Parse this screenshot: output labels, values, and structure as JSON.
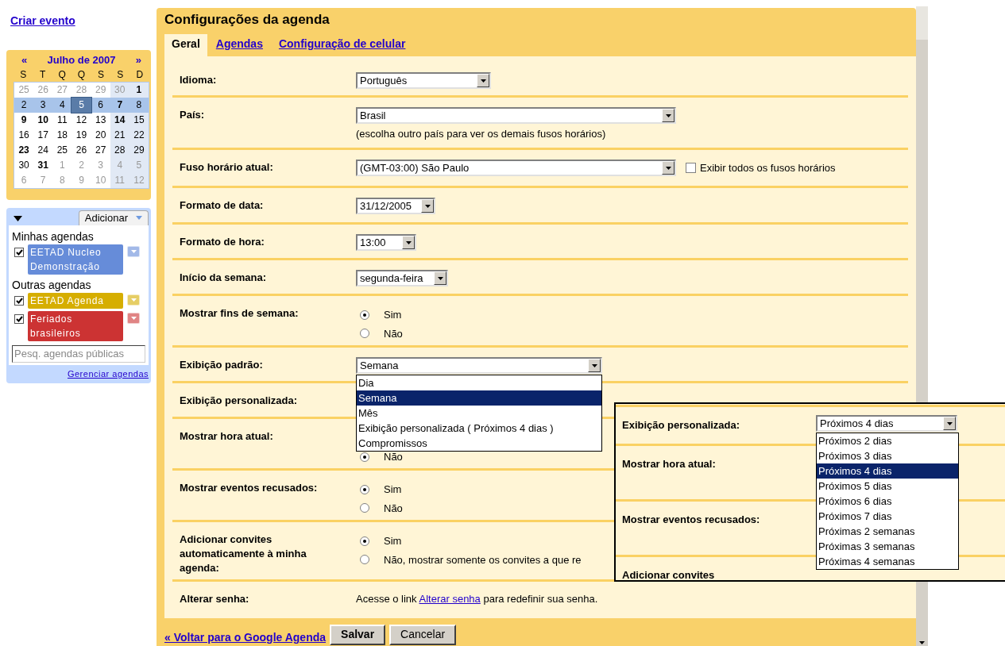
{
  "sidebar": {
    "create_event": "Criar evento",
    "mini_calendar": {
      "prev": "«",
      "title": "Julho de 2007",
      "next": "»",
      "weekdays": [
        "S",
        "T",
        "Q",
        "Q",
        "S",
        "S",
        "D"
      ],
      "weeks": [
        {
          "selected": false,
          "days": [
            {
              "d": "25",
              "kind": "other"
            },
            {
              "d": "26",
              "kind": "other"
            },
            {
              "d": "27",
              "kind": "other"
            },
            {
              "d": "28",
              "kind": "other"
            },
            {
              "d": "29",
              "kind": "other"
            },
            {
              "d": "30",
              "kind": "other"
            },
            {
              "d": "1",
              "kind": "bold"
            }
          ]
        },
        {
          "selected": true,
          "days": [
            {
              "d": "2",
              "kind": "plain"
            },
            {
              "d": "3",
              "kind": "plain"
            },
            {
              "d": "4",
              "kind": "plain"
            },
            {
              "d": "5",
              "kind": "today"
            },
            {
              "d": "6",
              "kind": "plain"
            },
            {
              "d": "7",
              "kind": "bold"
            },
            {
              "d": "8",
              "kind": "plain"
            }
          ]
        },
        {
          "selected": false,
          "days": [
            {
              "d": "9",
              "kind": "bold"
            },
            {
              "d": "10",
              "kind": "bold"
            },
            {
              "d": "11",
              "kind": "plain"
            },
            {
              "d": "12",
              "kind": "plain"
            },
            {
              "d": "13",
              "kind": "plain"
            },
            {
              "d": "14",
              "kind": "bold"
            },
            {
              "d": "15",
              "kind": "plain"
            }
          ]
        },
        {
          "selected": false,
          "days": [
            {
              "d": "16",
              "kind": "plain"
            },
            {
              "d": "17",
              "kind": "plain"
            },
            {
              "d": "18",
              "kind": "plain"
            },
            {
              "d": "19",
              "kind": "plain"
            },
            {
              "d": "20",
              "kind": "plain"
            },
            {
              "d": "21",
              "kind": "plain"
            },
            {
              "d": "22",
              "kind": "plain"
            }
          ]
        },
        {
          "selected": false,
          "days": [
            {
              "d": "23",
              "kind": "bold"
            },
            {
              "d": "24",
              "kind": "plain"
            },
            {
              "d": "25",
              "kind": "plain"
            },
            {
              "d": "26",
              "kind": "plain"
            },
            {
              "d": "27",
              "kind": "plain"
            },
            {
              "d": "28",
              "kind": "plain"
            },
            {
              "d": "29",
              "kind": "plain"
            }
          ]
        },
        {
          "selected": false,
          "days": [
            {
              "d": "30",
              "kind": "plain"
            },
            {
              "d": "31",
              "kind": "bold"
            },
            {
              "d": "1",
              "kind": "other"
            },
            {
              "d": "2",
              "kind": "other"
            },
            {
              "d": "3",
              "kind": "other"
            },
            {
              "d": "4",
              "kind": "other"
            },
            {
              "d": "5",
              "kind": "other"
            }
          ]
        },
        {
          "selected": false,
          "days": [
            {
              "d": "6",
              "kind": "other"
            },
            {
              "d": "7",
              "kind": "other"
            },
            {
              "d": "8",
              "kind": "other"
            },
            {
              "d": "9",
              "kind": "other"
            },
            {
              "d": "10",
              "kind": "other"
            },
            {
              "d": "11",
              "kind": "other"
            },
            {
              "d": "12",
              "kind": "other"
            }
          ]
        }
      ]
    },
    "calendars": {
      "add_button": "Adicionar",
      "groups": [
        {
          "title": "Minhas agendas",
          "items": [
            {
              "name": "EETAD Nucleo Demonstração",
              "checked": true,
              "color": "#668cd9"
            }
          ]
        },
        {
          "title": "Outras agendas",
          "items": [
            {
              "name": "EETAD Agenda",
              "checked": true,
              "color": "#d6ae00"
            },
            {
              "name": "Feriados brasileiros",
              "checked": true,
              "color": "#cc3333"
            }
          ]
        }
      ],
      "search": {
        "placeholder": "Pesq. agendas públicas"
      },
      "manage_link": "Gerenciar agendas"
    }
  },
  "settings": {
    "title": "Configurações da agenda",
    "tabs": [
      {
        "label": "Geral",
        "selected": true
      },
      {
        "label": "Agendas",
        "selected": false
      },
      {
        "label": "Configuração de celular",
        "selected": false
      }
    ],
    "rows": [
      {
        "kind": "select",
        "label": "Idioma:",
        "value": "Português"
      },
      {
        "kind": "select",
        "label": "País:",
        "value": "Brasil",
        "note": "(escolha outro país para ver os demais fusos horários)"
      },
      {
        "kind": "select",
        "label": "Fuso horário atual:",
        "value": "(GMT-03:00) São Paulo",
        "checkbox": {
          "label": "Exibir todos os fusos horários",
          "checked": false
        }
      },
      {
        "kind": "select",
        "label": "Formato de data:",
        "value": "31/12/2005"
      },
      {
        "kind": "select",
        "label": "Formato de hora:",
        "value": "13:00"
      },
      {
        "kind": "select",
        "label": "Início da semana:",
        "value": "segunda-feira"
      },
      {
        "kind": "radio",
        "label": "Mostrar fins de semana:",
        "options": [
          {
            "label": "Sim",
            "selected": true
          },
          {
            "label": "Não",
            "selected": false
          }
        ]
      },
      {
        "kind": "select",
        "label": "Exibição padrão:",
        "value": "Semana",
        "open": true,
        "options": [
          {
            "label": "Dia",
            "selected": false
          },
          {
            "label": "Semana",
            "selected": true
          },
          {
            "label": "Mês",
            "selected": false
          },
          {
            "label": "Exibição personalizada ( Próximos 4 dias )",
            "selected": false
          },
          {
            "label": "Compromissos",
            "selected": false
          }
        ]
      },
      {
        "kind": "blank",
        "label": "Exibição personalizada:"
      },
      {
        "kind": "radio",
        "label": "Mostrar hora atual:",
        "options": [
          {
            "label": "Não",
            "selected": true
          }
        ]
      },
      {
        "kind": "radio",
        "label": "Mostrar eventos recusados:",
        "options": [
          {
            "label": "Sim",
            "selected": true
          },
          {
            "label": "Não",
            "selected": false
          }
        ]
      },
      {
        "kind": "radio",
        "label": "Adicionar convites automaticamente à minha agenda:",
        "options": [
          {
            "label": "Sim",
            "selected": true
          },
          {
            "label": "Não, mostrar somente os convites a que re",
            "selected": false
          }
        ]
      },
      {
        "kind": "text",
        "label": "Alterar senha:",
        "before": "Acesse o link",
        "link": "Alterar senha",
        "after": "para redefinir sua senha."
      }
    ],
    "footer": {
      "back_link": "« Voltar para o Google Agenda",
      "buttons": [
        "Salvar",
        "Cancelar"
      ]
    }
  },
  "inset": {
    "rows": [
      {
        "kind": "select",
        "label": "Exibição personalizada:",
        "value": "Próximos 4 dias",
        "open": true,
        "options": [
          {
            "label": "Próximos 2 dias",
            "selected": false
          },
          {
            "label": "Próximos 3 dias",
            "selected": false
          },
          {
            "label": "Próximos 4 dias",
            "selected": true
          },
          {
            "label": "Próximos 5 dias",
            "selected": false
          },
          {
            "label": "Próximos 6 dias",
            "selected": false
          },
          {
            "label": "Próximos 7 dias",
            "selected": false
          },
          {
            "label": "Próximas 2 semanas",
            "selected": false
          },
          {
            "label": "Próximas 3 semanas",
            "selected": false
          },
          {
            "label": "Próximas 4 semanas",
            "selected": false
          }
        ]
      },
      {
        "kind": "blank",
        "label": "Mostrar hora atual:"
      },
      {
        "kind": "blank",
        "label": "Mostrar eventos recusados:"
      },
      {
        "kind": "blank",
        "label": "Adicionar convites"
      }
    ]
  }
}
